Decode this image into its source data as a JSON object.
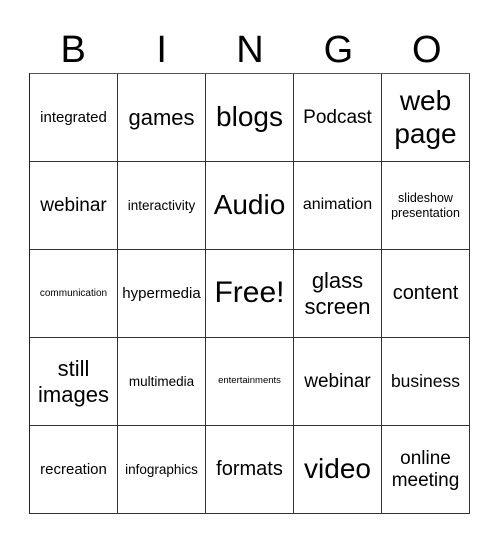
{
  "header": {
    "letters": [
      "B",
      "I",
      "N",
      "G",
      "O"
    ]
  },
  "rows": [
    [
      "integrated",
      "games",
      "blogs",
      "Podcast",
      "web page"
    ],
    [
      "webinar",
      "interactivity",
      "Audio",
      "animation",
      "slideshow presentation"
    ],
    [
      "communication",
      "hypermedia",
      "Free!",
      "glass screen",
      "content"
    ],
    [
      "still images",
      "multimedia",
      "entertainments",
      "webinar",
      "business"
    ],
    [
      "recreation",
      "infographics",
      "formats",
      "video",
      "online meeting"
    ]
  ]
}
